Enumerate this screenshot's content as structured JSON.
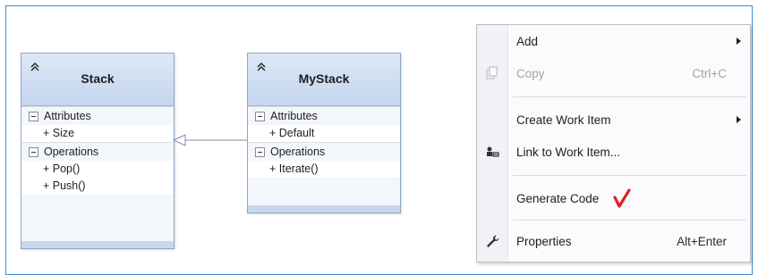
{
  "classes": {
    "stack": {
      "title": "Stack",
      "attributes_label": "Attributes",
      "attributes": [
        "+ Size"
      ],
      "operations_label": "Operations",
      "operations": [
        "+ Pop()",
        "+ Push()"
      ]
    },
    "mystack": {
      "title": "MyStack",
      "attributes_label": "Attributes",
      "attributes": [
        "+ Default"
      ],
      "operations_label": "Operations",
      "operations": [
        "+ Iterate()"
      ]
    }
  },
  "context_menu": {
    "items": [
      {
        "label": "Add",
        "shortcut": "",
        "submenu": true,
        "enabled": true,
        "icon": ""
      },
      {
        "label": "Copy",
        "shortcut": "Ctrl+C",
        "submenu": false,
        "enabled": false,
        "icon": "copy-icon"
      },
      {
        "label": "Create Work Item",
        "shortcut": "",
        "submenu": true,
        "enabled": true,
        "icon": ""
      },
      {
        "label": "Link to Work Item...",
        "shortcut": "",
        "submenu": false,
        "enabled": true,
        "icon": "link-work-item-icon"
      },
      {
        "label": "Generate Code",
        "shortcut": "",
        "submenu": false,
        "enabled": true,
        "icon": "",
        "annotation": "red-checkmark"
      },
      {
        "label": "Properties",
        "shortcut": "Alt+Enter",
        "submenu": false,
        "enabled": true,
        "icon": "wrench-icon"
      }
    ]
  },
  "colors": {
    "frame_border": "#3c8fd6",
    "class_header": "#c4d5ee",
    "checkmark": "#e02020"
  }
}
